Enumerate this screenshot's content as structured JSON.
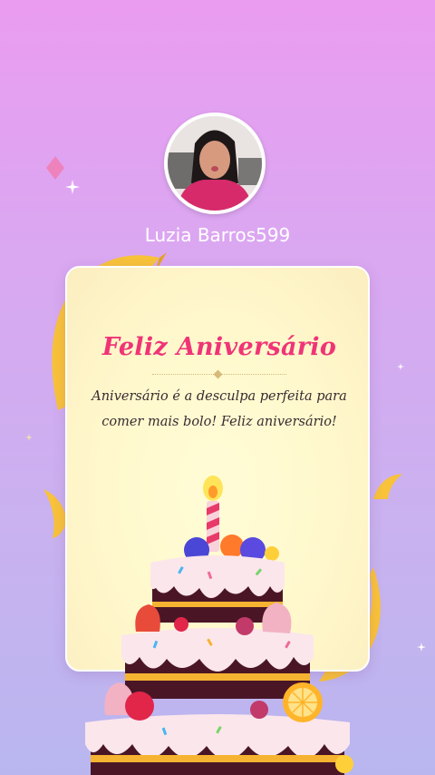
{
  "profile": {
    "username": "Luzia Barros599"
  },
  "card": {
    "title": "Feliz Aniversário",
    "message": "Aniversário é a desculpa perfeita para comer mais bolo! Feliz aniversário!"
  },
  "colors": {
    "title": "#f03477",
    "ribbon": "#f8c23a",
    "card_bg": "#fff8cc"
  },
  "icons": [
    "sparkle-icon",
    "diamond-icon",
    "birthday-cake-icon",
    "candle-icon"
  ]
}
